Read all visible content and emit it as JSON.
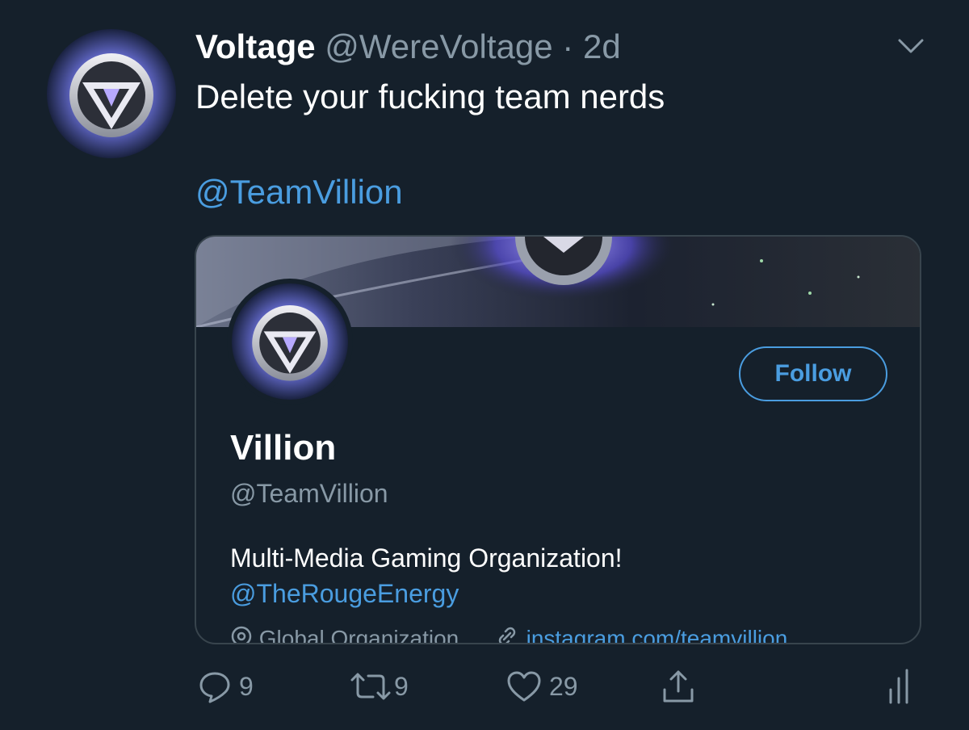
{
  "tweet": {
    "display_name": "Voltage",
    "handle": "@WereVoltage",
    "separator": "·",
    "time": "2d",
    "text": "Delete your fucking team nerds",
    "mention": "@TeamVillion"
  },
  "card": {
    "name": "Villion",
    "handle": "@TeamVillion",
    "follow_label": "Follow",
    "bio": "Multi-Media Gaming Organization!",
    "bio_mention": "@TheRougeEnergy",
    "location": "Global Organization",
    "link": "instagram.com/teamvillion"
  },
  "actions": {
    "reply_count": "9",
    "retweet_count": "9",
    "like_count": "29"
  },
  "colors": {
    "background": "#15202b",
    "accent": "#4a9de0",
    "secondary_text": "#8899a6",
    "border": "#38444d"
  },
  "icons": {
    "menu": "chevron-down-icon",
    "reply": "reply-icon",
    "retweet": "retweet-icon",
    "like": "heart-icon",
    "share": "share-icon",
    "analytics": "analytics-icon",
    "location": "location-icon",
    "link": "link-icon"
  }
}
